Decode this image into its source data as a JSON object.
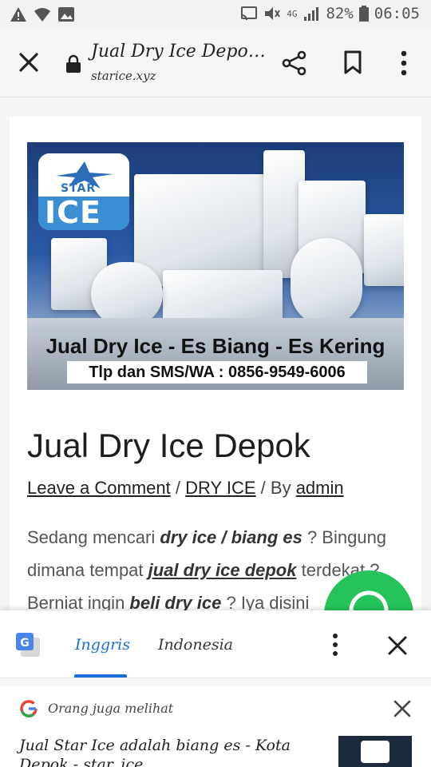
{
  "status_bar": {
    "battery_percent": "82%",
    "time": "06:05",
    "network": "4G"
  },
  "toolbar": {
    "page_title": "Jual Dry Ice Depo…",
    "url": "starice.xyz",
    "icons": [
      "close-icon",
      "lock-icon",
      "share-icon",
      "bookmark-icon",
      "more-vert-icon"
    ]
  },
  "hero": {
    "logo_brand": "STAR",
    "logo_word": "ICE",
    "caption": "Jual Dry Ice - Es Biang - Es Kering",
    "phone": "Tlp dan SMS/WA : 0856-9549-6006"
  },
  "article": {
    "title": "Jual Dry Ice Depok",
    "meta_comment": "Leave a Comment",
    "meta_sep1": " / ",
    "meta_category": "DRY ICE",
    "meta_by": " / By ",
    "meta_author": "admin",
    "p1_a": "Sedang mencari ",
    "p1_b": "dry ice / biang es",
    "p1_c": " ? Bingung dimana tempat ",
    "p1_link": "jual dry ice depok",
    "p1_d": " terdekat ? Berniat ingin ",
    "p1_e": "beli dry ice",
    "p1_f": " ? Iya disini"
  },
  "translate": {
    "lang_source": "Inggris",
    "lang_target": "Indonesia"
  },
  "people_also_view": {
    "heading": "Orang juga melihat",
    "result_text": "Jual Star Ice adalah biang es - Kota Depok - star_ice"
  },
  "colors": {
    "accent_blue": "#1a6fd6",
    "whatsapp_green": "#25c35a"
  }
}
